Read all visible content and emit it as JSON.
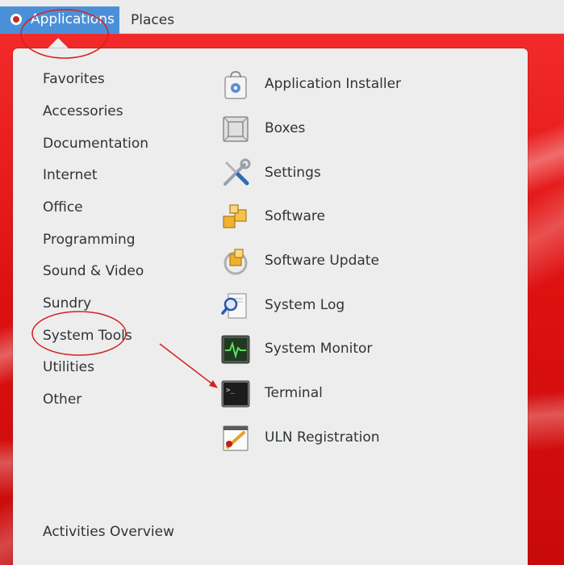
{
  "topbar": {
    "applications_label": "Applications",
    "places_label": "Places"
  },
  "categories": [
    "Favorites",
    "Accessories",
    "Documentation",
    "Internet",
    "Office",
    "Programming",
    "Sound & Video",
    "Sundry",
    "System Tools",
    "Utilities",
    "Other"
  ],
  "apps": [
    {
      "label": "Application Installer",
      "icon": "application-installer-icon"
    },
    {
      "label": "Boxes",
      "icon": "boxes-icon"
    },
    {
      "label": "Settings",
      "icon": "settings-icon"
    },
    {
      "label": "Software",
      "icon": "software-icon"
    },
    {
      "label": "Software Update",
      "icon": "software-update-icon"
    },
    {
      "label": "System Log",
      "icon": "system-log-icon"
    },
    {
      "label": "System Monitor",
      "icon": "system-monitor-icon"
    },
    {
      "label": "Terminal",
      "icon": "terminal-icon"
    },
    {
      "label": "ULN Registration",
      "icon": "uln-registration-icon"
    }
  ],
  "footer": {
    "activities_label": "Activities Overview"
  },
  "colors": {
    "panel_bg": "#ececec",
    "selected_bg": "#4a90d9",
    "annotation": "#d42020",
    "wallpaper": "#e31a1a"
  }
}
